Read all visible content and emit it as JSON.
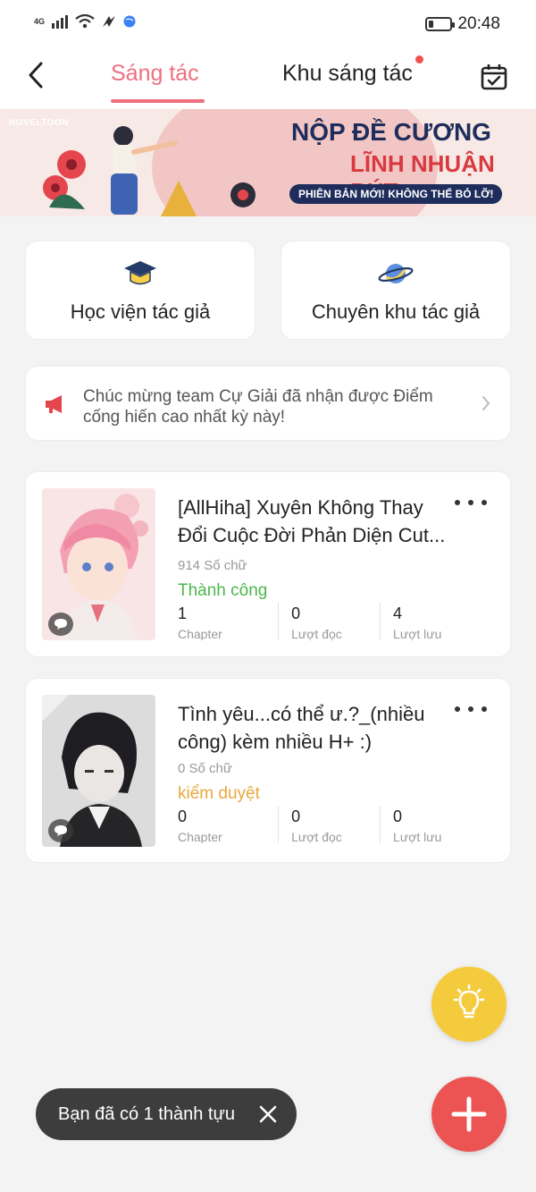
{
  "status_bar": {
    "network": "4G",
    "time": "20:48"
  },
  "nav": {
    "tab_active": "Sáng tác",
    "tab_inactive": "Khu sáng tác"
  },
  "banner": {
    "logo": "NOVELTOON",
    "title": "NỘP ĐỀ CƯƠNG",
    "subtitle": "LĨNH NHUẬN BÚT",
    "pill": "PHIÊN BẢN MỚI! KHÔNG THỂ BỎ LỠ!"
  },
  "features": [
    {
      "label": "Học viện tác giả",
      "icon": "graduation-cap-icon"
    },
    {
      "label": "Chuyên khu tác giả",
      "icon": "planet-icon"
    }
  ],
  "notice": {
    "text": "Chúc mừng team Cự Giải đã nhận được Điểm cống hiến cao nhất kỳ này!"
  },
  "books": [
    {
      "title": "[AllHiha] Xuyên Không Thay Đổi Cuộc Đời Phản Diện Cut...",
      "words": "914 Số chữ",
      "status": "Thành công",
      "status_color": "#4cb84c",
      "stats": [
        {
          "value": "1",
          "label": "Chapter"
        },
        {
          "value": "0",
          "label": "Lượt đọc"
        },
        {
          "value": "4",
          "label": "Lượt lưu"
        }
      ]
    },
    {
      "title": "Tình yêu...có thể ư.?_(nhiều công) kèm nhiều H+ :)",
      "words": "0 Số chữ",
      "status": "kiểm duyệt",
      "status_color": "#e8a83b",
      "stats": [
        {
          "value": "0",
          "label": "Chapter"
        },
        {
          "value": "0",
          "label": "Lượt đọc"
        },
        {
          "value": "0",
          "label": "Lượt lưu"
        }
      ]
    }
  ],
  "toast": {
    "text": "Bạn đã có 1 thành tựu"
  },
  "colors": {
    "accent": "#ef6f80",
    "fab_idea": "#f5cb3e",
    "fab_add": "#ec5454"
  }
}
